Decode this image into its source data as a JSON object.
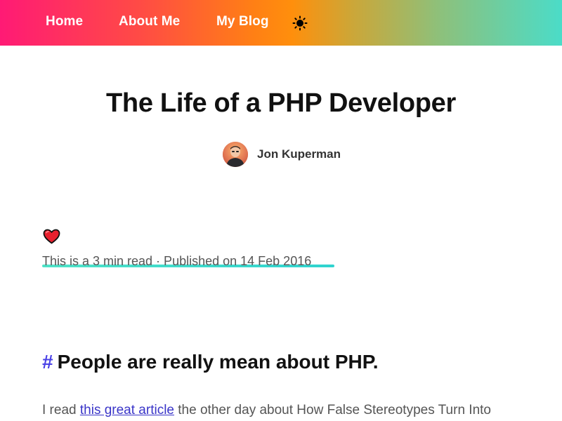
{
  "nav": {
    "items": [
      {
        "label": "Home"
      },
      {
        "label": "About Me"
      },
      {
        "label": "My Blog"
      }
    ],
    "theme_icon": "sun-icon"
  },
  "post": {
    "title": "The Life of a PHP Developer",
    "author": {
      "name": "Jon Kuperman",
      "avatar_icon": "avatar"
    },
    "like_icon": "heart-icon",
    "meta": "This is a 3 min read · Published on 14 Feb 2016",
    "section_heading": "People are really mean about PHP.",
    "section_hash": "#",
    "paragraph": {
      "before": "I read ",
      "link": "this great article",
      "after": " the other day about How False Stereotypes Turn Into"
    }
  },
  "colors": {
    "hash_accent": "#4940e6",
    "underline_accent": "#2fd3cf",
    "link": "#3a35c8"
  }
}
